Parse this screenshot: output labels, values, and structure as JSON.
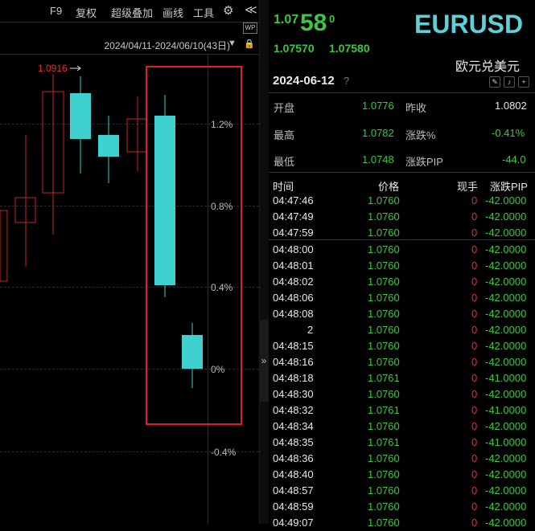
{
  "toolbar": {
    "items": [
      "F9",
      "复权",
      "超级叠加",
      "画线",
      "工具"
    ],
    "gear": "⚙",
    "collapse": "≪",
    "wp_badge": "WP"
  },
  "chart": {
    "date_range": "2024/04/11-2024/06/10(43日)",
    "high_marker": "1.0916",
    "pct_labels": [
      "1.2%",
      "0.8%",
      "0.4%",
      "0%",
      "-0.4%"
    ],
    "splitter_arrow": "»",
    "candles": [
      {
        "open": 1.087,
        "close": 1.0803,
        "high": 1.0916,
        "low": 1.079,
        "color": "red"
      },
      {
        "open": 1.0803,
        "close": 1.079,
        "high": 1.0826,
        "low": 1.0782,
        "color": "red"
      },
      {
        "open": 1.0776,
        "close": 1.078,
        "high": 1.0796,
        "low": 1.077,
        "color": "red"
      },
      {
        "open": 1.0769,
        "close": 1.0762,
        "high": 1.0773,
        "low": 1.0748,
        "color": "red"
      }
    ]
  },
  "quote": {
    "price_small": "1.07",
    "price_big": "58",
    "price_sup": "0",
    "bid": "1.07570",
    "ask": "1.07580",
    "symbol": "EURUSD",
    "name": "欧元兑美元",
    "date": "2024-06-12",
    "help": "?"
  },
  "stats": {
    "open_label": "开盘",
    "open": "1.0776",
    "prev_label": "昨收",
    "prev": "1.0802",
    "high_label": "最高",
    "high": "1.0782",
    "chg_pct_label": "涨跌%",
    "chg_pct": "-0.41%",
    "low_label": "最低",
    "low": "1.0748",
    "chg_pip_label": "涨跌PIP",
    "chg_pip": "-44.0"
  },
  "ticks": {
    "headers": [
      "时间",
      "价格",
      "现手",
      "涨跌PIP"
    ],
    "rows": [
      [
        "04:47:46",
        "1.0760",
        "0",
        "-42.0000"
      ],
      [
        "04:47:49",
        "1.0760",
        "0",
        "-42.0000"
      ],
      [
        "04:47:59",
        "1.0760",
        "0",
        "-42.0000"
      ],
      [
        "04:48:00",
        "1.0760",
        "0",
        "-42.0000"
      ],
      [
        "04:48:01",
        "1.0760",
        "0",
        "-42.0000"
      ],
      [
        "04:48:02",
        "1.0760",
        "0",
        "-42.0000"
      ],
      [
        "04:48:06",
        "1.0760",
        "0",
        "-42.0000"
      ],
      [
        "04:48:08",
        "1.0760",
        "0",
        "-42.0000"
      ],
      [
        "2",
        "1.0760",
        "0",
        "-42.0000"
      ],
      [
        "04:48:15",
        "1.0760",
        "0",
        "-42.0000"
      ],
      [
        "04:48:16",
        "1.0760",
        "0",
        "-42.0000"
      ],
      [
        "04:48:18",
        "1.0761",
        "0",
        "-41.0000"
      ],
      [
        "04:48:30",
        "1.0760",
        "0",
        "-42.0000"
      ],
      [
        "04:48:32",
        "1.0761",
        "0",
        "-41.0000"
      ],
      [
        "04:48:34",
        "1.0760",
        "0",
        "-42.0000"
      ],
      [
        "04:48:35",
        "1.0761",
        "0",
        "-41.0000"
      ],
      [
        "04:48:36",
        "1.0760",
        "0",
        "-42.0000"
      ],
      [
        "04:48:40",
        "1.0760",
        "0",
        "-42.0000"
      ],
      [
        "04:48:57",
        "1.0760",
        "0",
        "-42.0000"
      ],
      [
        "04:48:59",
        "1.0760",
        "0",
        "-42.0000"
      ],
      [
        "04:49:07",
        "1.0760",
        "0",
        "-42.0000"
      ]
    ]
  }
}
